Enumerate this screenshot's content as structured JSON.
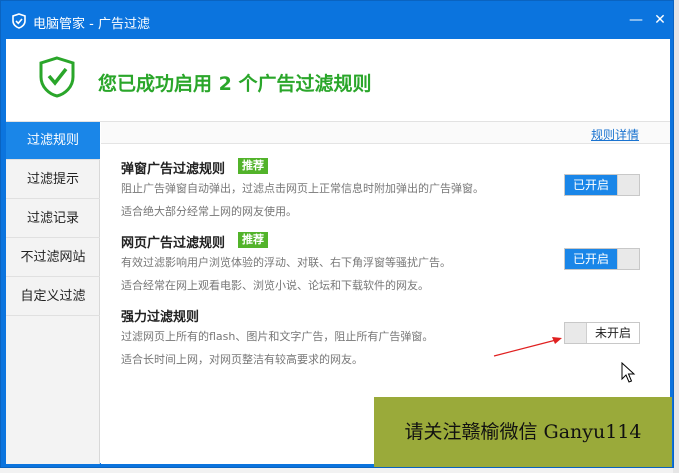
{
  "window": {
    "title": "电脑管家 - 广告过滤",
    "minimize_glyph": "—",
    "close_glyph": "✕"
  },
  "header": {
    "headline": "您已成功启用 2 个广告过滤规则",
    "icon": "shield-check-icon",
    "accent_color": "#2aa62a"
  },
  "sidebar": {
    "items": [
      {
        "label": "过滤规则",
        "active": true
      },
      {
        "label": "过滤提示",
        "active": false
      },
      {
        "label": "过滤记录",
        "active": false
      },
      {
        "label": "不过滤网站",
        "active": false
      },
      {
        "label": "自定义过滤",
        "active": false
      }
    ]
  },
  "content": {
    "rule_detail_link": "规则详情",
    "rules": [
      {
        "title": "弹窗广告过滤规则",
        "badge": "推荐",
        "desc1": "阻止广告弹窗自动弹出，过滤点击网页上正常信息时附加弹出的广告弹窗。",
        "desc2": "适合绝大部分经常上网的网友使用。",
        "toggle_label": "已开启",
        "enabled": true
      },
      {
        "title": "网页广告过滤规则",
        "badge": "推荐",
        "desc1": "有效过滤影响用户浏览体验的浮动、对联、右下角浮窗等骚扰广告。",
        "desc2": "适合经常在网上观看电影、浏览小说、论坛和下载软件的网友。",
        "toggle_label": "已开启",
        "enabled": true
      },
      {
        "title": "强力过滤规则",
        "badge": "",
        "desc1": "过滤网页上所有的flash、图片和文字广告，阻止所有广告弹窗。",
        "desc2": "适合长时间上网，对网页整洁有较高要求的网友。",
        "toggle_label": "未开启",
        "enabled": false
      }
    ]
  },
  "watermark": {
    "text": "请关注赣榆微信 Ganyu114"
  },
  "colors": {
    "title_bar": "#0b74de",
    "toggle_on": "#1a86e8",
    "badge": "#52b32a",
    "annotation_arrow": "#e02020"
  }
}
